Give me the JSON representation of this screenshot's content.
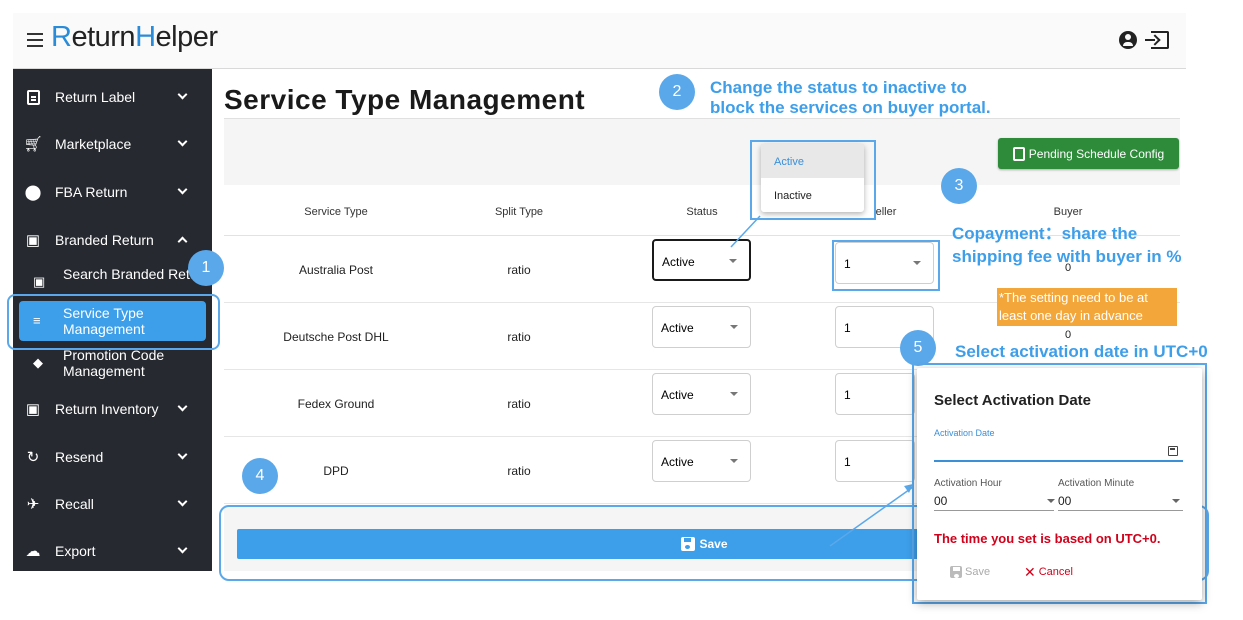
{
  "header": {
    "logo_text": "ReturnHelper",
    "logo_part1": "R",
    "logo_part2": "eturn",
    "logo_part3": "H",
    "logo_part4": "elper"
  },
  "sidebar": {
    "items": [
      {
        "label": "Return Label",
        "icon": "clipboard-icon"
      },
      {
        "label": "Marketplace",
        "icon": "cart-icon"
      },
      {
        "label": "FBA Return",
        "icon": "dots-icon"
      },
      {
        "label": "Branded Return",
        "icon": "calendar-icon"
      },
      {
        "label": "Search Branded Return",
        "icon": "search-icon"
      },
      {
        "label": "Service Type Management",
        "icon": "sliders-icon"
      },
      {
        "label": "Promotion Code Management",
        "icon": "tag-icon"
      },
      {
        "label": "Return Inventory",
        "icon": "archive-icon"
      },
      {
        "label": "Resend",
        "icon": "sync-icon"
      },
      {
        "label": "Recall",
        "icon": "airplane-icon"
      },
      {
        "label": "Export",
        "icon": "cloud-icon"
      }
    ]
  },
  "main": {
    "title": "Service Type Management",
    "pending_button": "Pending Schedule Config",
    "save_button": "Save"
  },
  "table": {
    "headers": [
      "Service Type",
      "Split Type",
      "Status",
      "eller",
      "Buyer"
    ],
    "rows": [
      {
        "service": "Australia Post",
        "split": "ratio",
        "status": "Active",
        "seller": "1",
        "buyer": "0"
      },
      {
        "service": "Deutsche Post DHL",
        "split": "ratio",
        "status": "Active",
        "seller": "1",
        "buyer": "0"
      },
      {
        "service": "Fedex Ground",
        "split": "ratio",
        "status": "Active",
        "seller": "1",
        "buyer": ""
      },
      {
        "service": "DPD",
        "split": "ratio",
        "status": "Active",
        "seller": "1",
        "buyer": ""
      }
    ]
  },
  "dropdown": {
    "options": [
      "Active",
      "Inactive"
    ],
    "selected": "Active"
  },
  "annotations": {
    "badge1": "1",
    "badge2": "2",
    "badge3": "3",
    "badge4": "4",
    "badge5": "5",
    "note2_line1": "Change the status to inactive to",
    "note2_line2": "block the services on buyer portal.",
    "note3_line1": "Copayment：share the",
    "note3_line2": "shipping fee with buyer in %",
    "note3_warning": "*The setting need to be at least one day in advance",
    "note5": "Select activation date in UTC+0"
  },
  "dialog": {
    "title": "Select Activation Date",
    "date_label": "Activation Date",
    "hour_label": "Activation Hour",
    "hour_value": "00",
    "minute_label": "Activation Minute",
    "minute_value": "00",
    "warning": "The time you set is based on UTC+0.",
    "save": "Save",
    "cancel": "Cancel"
  },
  "colors": {
    "accent": "#3d9ee9",
    "annotation": "#5aa8ea",
    "sidebar_bg": "#26292f",
    "pending_btn": "#2e8b3a",
    "warning_bg": "#f3a63a",
    "error_red": "#d0021b"
  }
}
